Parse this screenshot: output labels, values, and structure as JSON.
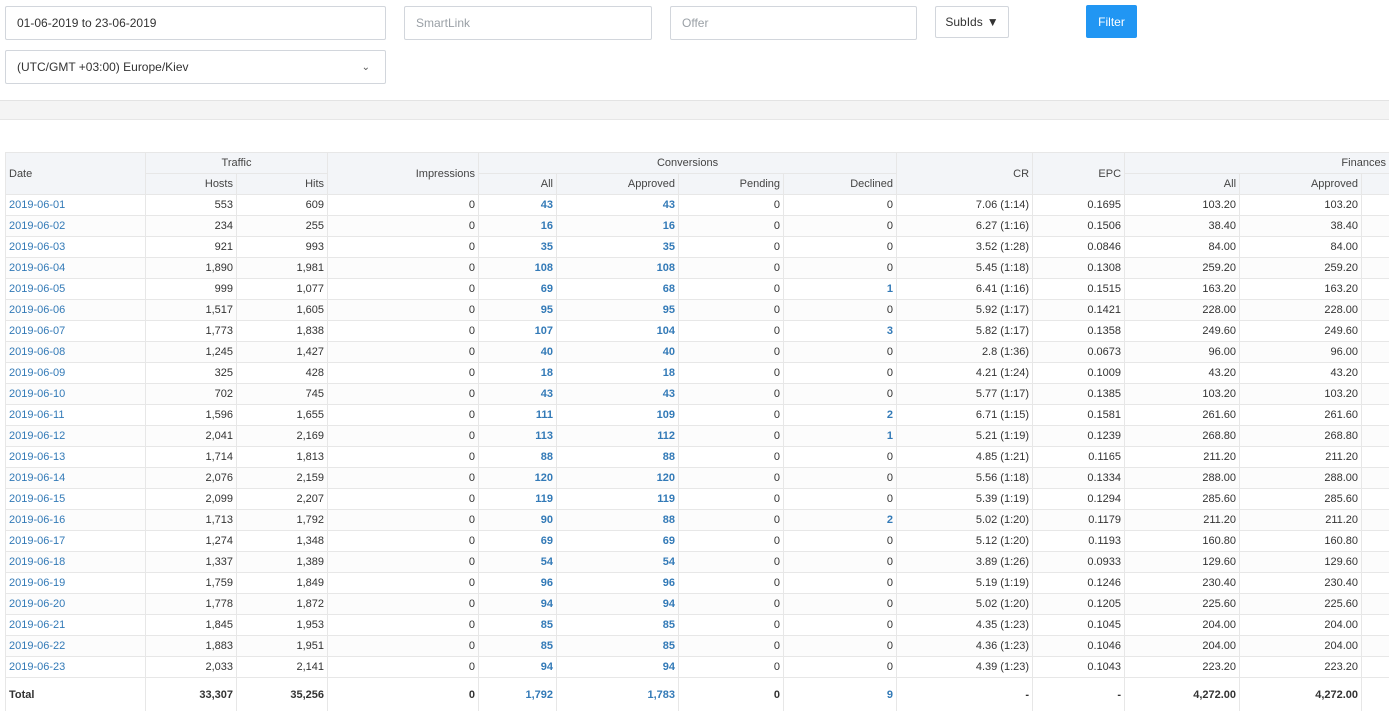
{
  "filters": {
    "date_range": "01-06-2019 to 23-06-2019",
    "smartlink_placeholder": "SmartLink",
    "offer_placeholder": "Offer",
    "subids_label": "SubIds",
    "subids_caret": "▼",
    "filter_label": "Filter",
    "timezone": "(UTC/GMT +03:00) Europe/Kiev",
    "timezone_chevron": "⌄"
  },
  "table": {
    "group_headers": {
      "date": "Date",
      "traffic": "Traffic",
      "impressions": "Impressions",
      "conversions": "Conversions",
      "cr": "CR",
      "epc": "EPC",
      "finances": "Finances"
    },
    "sub_headers": {
      "hosts": "Hosts",
      "hits": "Hits",
      "conv_all": "All",
      "conv_approved": "Approved",
      "conv_pending": "Pending",
      "conv_declined": "Declined",
      "fin_all": "All",
      "fin_approved": "Approved"
    },
    "rows": [
      {
        "date": "2019-06-01",
        "hosts": "553",
        "hits": "609",
        "impressions": "0",
        "all": "43",
        "approved": "43",
        "pending": "0",
        "declined": "0",
        "cr": "7.06 (1:14)",
        "epc": "0.1695",
        "fin_all": "103.20",
        "fin_approved": "103.20"
      },
      {
        "date": "2019-06-02",
        "hosts": "234",
        "hits": "255",
        "impressions": "0",
        "all": "16",
        "approved": "16",
        "pending": "0",
        "declined": "0",
        "cr": "6.27 (1:16)",
        "epc": "0.1506",
        "fin_all": "38.40",
        "fin_approved": "38.40"
      },
      {
        "date": "2019-06-03",
        "hosts": "921",
        "hits": "993",
        "impressions": "0",
        "all": "35",
        "approved": "35",
        "pending": "0",
        "declined": "0",
        "cr": "3.52 (1:28)",
        "epc": "0.0846",
        "fin_all": "84.00",
        "fin_approved": "84.00"
      },
      {
        "date": "2019-06-04",
        "hosts": "1,890",
        "hits": "1,981",
        "impressions": "0",
        "all": "108",
        "approved": "108",
        "pending": "0",
        "declined": "0",
        "cr": "5.45 (1:18)",
        "epc": "0.1308",
        "fin_all": "259.20",
        "fin_approved": "259.20"
      },
      {
        "date": "2019-06-05",
        "hosts": "999",
        "hits": "1,077",
        "impressions": "0",
        "all": "69",
        "approved": "68",
        "pending": "0",
        "declined": "1",
        "cr": "6.41 (1:16)",
        "epc": "0.1515",
        "fin_all": "163.20",
        "fin_approved": "163.20"
      },
      {
        "date": "2019-06-06",
        "hosts": "1,517",
        "hits": "1,605",
        "impressions": "0",
        "all": "95",
        "approved": "95",
        "pending": "0",
        "declined": "0",
        "cr": "5.92 (1:17)",
        "epc": "0.1421",
        "fin_all": "228.00",
        "fin_approved": "228.00"
      },
      {
        "date": "2019-06-07",
        "hosts": "1,773",
        "hits": "1,838",
        "impressions": "0",
        "all": "107",
        "approved": "104",
        "pending": "0",
        "declined": "3",
        "cr": "5.82 (1:17)",
        "epc": "0.1358",
        "fin_all": "249.60",
        "fin_approved": "249.60"
      },
      {
        "date": "2019-06-08",
        "hosts": "1,245",
        "hits": "1,427",
        "impressions": "0",
        "all": "40",
        "approved": "40",
        "pending": "0",
        "declined": "0",
        "cr": "2.8 (1:36)",
        "epc": "0.0673",
        "fin_all": "96.00",
        "fin_approved": "96.00"
      },
      {
        "date": "2019-06-09",
        "hosts": "325",
        "hits": "428",
        "impressions": "0",
        "all": "18",
        "approved": "18",
        "pending": "0",
        "declined": "0",
        "cr": "4.21 (1:24)",
        "epc": "0.1009",
        "fin_all": "43.20",
        "fin_approved": "43.20"
      },
      {
        "date": "2019-06-10",
        "hosts": "702",
        "hits": "745",
        "impressions": "0",
        "all": "43",
        "approved": "43",
        "pending": "0",
        "declined": "0",
        "cr": "5.77 (1:17)",
        "epc": "0.1385",
        "fin_all": "103.20",
        "fin_approved": "103.20"
      },
      {
        "date": "2019-06-11",
        "hosts": "1,596",
        "hits": "1,655",
        "impressions": "0",
        "all": "111",
        "approved": "109",
        "pending": "0",
        "declined": "2",
        "cr": "6.71 (1:15)",
        "epc": "0.1581",
        "fin_all": "261.60",
        "fin_approved": "261.60"
      },
      {
        "date": "2019-06-12",
        "hosts": "2,041",
        "hits": "2,169",
        "impressions": "0",
        "all": "113",
        "approved": "112",
        "pending": "0",
        "declined": "1",
        "cr": "5.21 (1:19)",
        "epc": "0.1239",
        "fin_all": "268.80",
        "fin_approved": "268.80"
      },
      {
        "date": "2019-06-13",
        "hosts": "1,714",
        "hits": "1,813",
        "impressions": "0",
        "all": "88",
        "approved": "88",
        "pending": "0",
        "declined": "0",
        "cr": "4.85 (1:21)",
        "epc": "0.1165",
        "fin_all": "211.20",
        "fin_approved": "211.20"
      },
      {
        "date": "2019-06-14",
        "hosts": "2,076",
        "hits": "2,159",
        "impressions": "0",
        "all": "120",
        "approved": "120",
        "pending": "0",
        "declined": "0",
        "cr": "5.56 (1:18)",
        "epc": "0.1334",
        "fin_all": "288.00",
        "fin_approved": "288.00"
      },
      {
        "date": "2019-06-15",
        "hosts": "2,099",
        "hits": "2,207",
        "impressions": "0",
        "all": "119",
        "approved": "119",
        "pending": "0",
        "declined": "0",
        "cr": "5.39 (1:19)",
        "epc": "0.1294",
        "fin_all": "285.60",
        "fin_approved": "285.60"
      },
      {
        "date": "2019-06-16",
        "hosts": "1,713",
        "hits": "1,792",
        "impressions": "0",
        "all": "90",
        "approved": "88",
        "pending": "0",
        "declined": "2",
        "cr": "5.02 (1:20)",
        "epc": "0.1179",
        "fin_all": "211.20",
        "fin_approved": "211.20"
      },
      {
        "date": "2019-06-17",
        "hosts": "1,274",
        "hits": "1,348",
        "impressions": "0",
        "all": "69",
        "approved": "69",
        "pending": "0",
        "declined": "0",
        "cr": "5.12 (1:20)",
        "epc": "0.1193",
        "fin_all": "160.80",
        "fin_approved": "160.80"
      },
      {
        "date": "2019-06-18",
        "hosts": "1,337",
        "hits": "1,389",
        "impressions": "0",
        "all": "54",
        "approved": "54",
        "pending": "0",
        "declined": "0",
        "cr": "3.89 (1:26)",
        "epc": "0.0933",
        "fin_all": "129.60",
        "fin_approved": "129.60"
      },
      {
        "date": "2019-06-19",
        "hosts": "1,759",
        "hits": "1,849",
        "impressions": "0",
        "all": "96",
        "approved": "96",
        "pending": "0",
        "declined": "0",
        "cr": "5.19 (1:19)",
        "epc": "0.1246",
        "fin_all": "230.40",
        "fin_approved": "230.40"
      },
      {
        "date": "2019-06-20",
        "hosts": "1,778",
        "hits": "1,872",
        "impressions": "0",
        "all": "94",
        "approved": "94",
        "pending": "0",
        "declined": "0",
        "cr": "5.02 (1:20)",
        "epc": "0.1205",
        "fin_all": "225.60",
        "fin_approved": "225.60"
      },
      {
        "date": "2019-06-21",
        "hosts": "1,845",
        "hits": "1,953",
        "impressions": "0",
        "all": "85",
        "approved": "85",
        "pending": "0",
        "declined": "0",
        "cr": "4.35 (1:23)",
        "epc": "0.1045",
        "fin_all": "204.00",
        "fin_approved": "204.00"
      },
      {
        "date": "2019-06-22",
        "hosts": "1,883",
        "hits": "1,951",
        "impressions": "0",
        "all": "85",
        "approved": "85",
        "pending": "0",
        "declined": "0",
        "cr": "4.36 (1:23)",
        "epc": "0.1046",
        "fin_all": "204.00",
        "fin_approved": "204.00"
      },
      {
        "date": "2019-06-23",
        "hosts": "2,033",
        "hits": "2,141",
        "impressions": "0",
        "all": "94",
        "approved": "94",
        "pending": "0",
        "declined": "0",
        "cr": "4.39 (1:23)",
        "epc": "0.1043",
        "fin_all": "223.20",
        "fin_approved": "223.20"
      }
    ],
    "total": {
      "label": "Total",
      "hosts": "33,307",
      "hits": "35,256",
      "impressions": "0",
      "all": "1,792",
      "approved": "1,783",
      "pending": "0",
      "declined": "9",
      "cr": "-",
      "epc": "-",
      "fin_all": "4,272.00",
      "fin_approved": "4,272.00"
    }
  },
  "colors": {
    "link": "#337ab7",
    "filter_button": "#2196f3",
    "header_bg": "#f3f5f8"
  }
}
